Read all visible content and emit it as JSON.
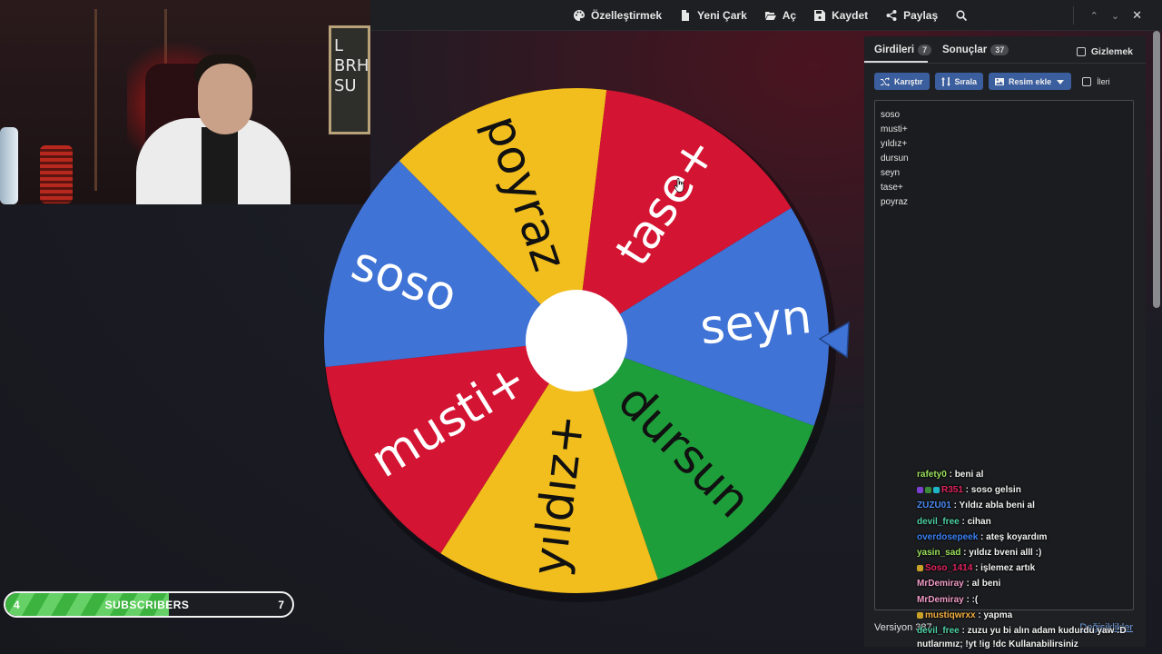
{
  "toolbar": {
    "items": [
      {
        "label": "Özelleştirmek",
        "icon": "palette-icon"
      },
      {
        "label": "Yeni Çark",
        "icon": "file-icon"
      },
      {
        "label": "Aç",
        "icon": "folder-open-icon"
      },
      {
        "label": "Kaydet",
        "icon": "save-icon"
      },
      {
        "label": "Paylaş",
        "icon": "share-icon"
      }
    ],
    "search_icon": "search-icon"
  },
  "window_controls": {
    "up": "⌃",
    "down": "⌄",
    "close": "✕"
  },
  "webcam": {
    "board_text": "L\nBRH\nSU"
  },
  "wheel": {
    "segments": [
      {
        "label": "seyn",
        "color": "#3f73d6"
      },
      {
        "label": "dursun",
        "color": "#1e9e3a"
      },
      {
        "label": "yıldız+",
        "color": "#f2be1d"
      },
      {
        "label": "musti+",
        "color": "#d41433"
      },
      {
        "label": "soso",
        "color": "#3f73d6"
      },
      {
        "label": "poyraz",
        "color": "#f2be1d"
      },
      {
        "label": "tase+",
        "color": "#d41433"
      }
    ],
    "pointer_color": "#3f73d6",
    "center_color": "#ffffff"
  },
  "panel": {
    "tab_entries": {
      "label": "Girdileri",
      "count": "7"
    },
    "tab_results": {
      "label": "Sonuçlar",
      "count": "37"
    },
    "hide_label": "Gizlemek",
    "shuffle_label": "Karıştır",
    "sort_label": "Sırala",
    "add_image_label": "Resim ekle",
    "advanced_label": "İleri",
    "entries": [
      "soso",
      "musti+",
      "yıldız+",
      "dursun",
      "seyn",
      "tase+",
      "poyraz"
    ],
    "version": "Versiyon 387",
    "updates": "Değişiklikler"
  },
  "chat": {
    "lines": [
      {
        "user": "rafety0",
        "msg": " : beni al",
        "color": "#9be15d",
        "badges": []
      },
      {
        "user": "R351",
        "msg": " : soso gelsin",
        "color": "#e0245e",
        "badges": [
          "#7b3fd1",
          "#3a8a3a",
          "#1fb5c9"
        ]
      },
      {
        "user": "ZUZU01",
        "msg": " : Yıldız abla beni al",
        "color": "#4c8bf5",
        "badges": []
      },
      {
        "user": "devil_free",
        "msg": " : cihan",
        "color": "#4fd1a5",
        "badges": []
      },
      {
        "user": "overdosepeek",
        "msg": " : ateş koyardım",
        "color": "#3b82f6",
        "badges": []
      },
      {
        "user": "yasin_sad",
        "msg": " : yıldız bveni alll :)",
        "color": "#9be15d",
        "badges": []
      },
      {
        "user": "Soso_1414",
        "msg": " : işlemez artık",
        "color": "#e0245e",
        "badges": [
          "#c9a227"
        ]
      },
      {
        "user": "MrDemiray",
        "msg": " : al beni",
        "color": "#f19bc7",
        "badges": []
      },
      {
        "user": "MrDemiray",
        "msg": " : :(",
        "color": "#f19bc7",
        "badges": []
      },
      {
        "user": "mustiqwrxx",
        "msg": " : yapma",
        "color": "#f5b041",
        "badges": [
          "#c9a227"
        ]
      },
      {
        "user": "devil_free",
        "msg": " : zuzu yu bi alın adam kudurdu yaw :D",
        "color": "#4fd1a5",
        "badges": []
      }
    ],
    "footer": "nutlarımız; !yt !ig !dc Kullanabilirsiniz"
  },
  "subscribers": {
    "current": "4",
    "label": "SUBSCRIBERS",
    "goal": "7",
    "progress": 0.57
  }
}
